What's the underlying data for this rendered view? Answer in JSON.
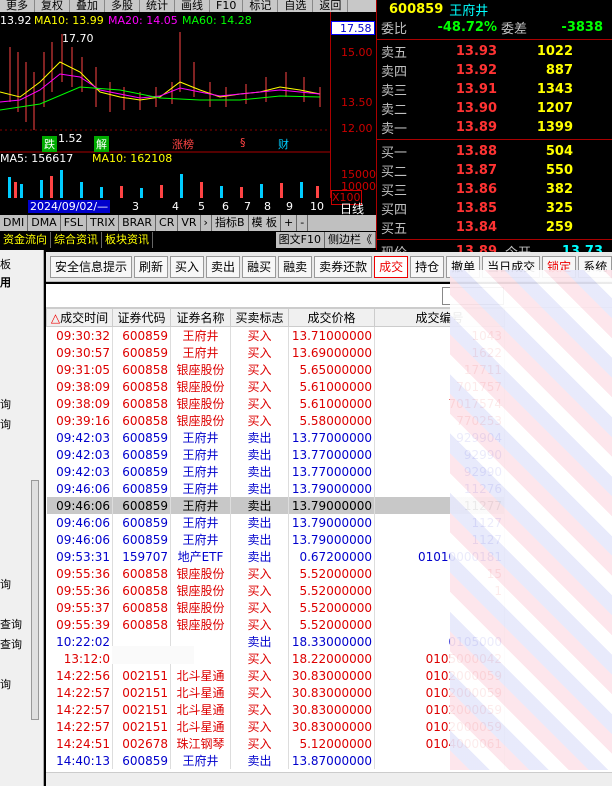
{
  "top_menu": [
    "更多",
    "复权",
    "叠加",
    "多股",
    "统计",
    "画线",
    "F10",
    "标记",
    "自选",
    "返回"
  ],
  "kline": {
    "ma_price": "13.92",
    "ma10": "MA10: 13.99",
    "ma20": "MA20: 14.05",
    "ma60": "MA60: 14.28",
    "high_label": "17.70",
    "low_label": "1.52",
    "events": [
      "跌",
      "解",
      "涨榜",
      "§",
      "财"
    ],
    "vol_ma5": "MA5: 156617",
    "vol_ma10": "MA10: 162108",
    "date_label": "2024/09/02/—",
    "x_ticks": [
      "3",
      "4",
      "5",
      "6",
      "7",
      "8",
      "9",
      "10"
    ],
    "axis": [
      "17.58",
      "15.00",
      "13.50",
      "12.00",
      "15000",
      "10000",
      "X100"
    ],
    "period_label": "日线",
    "colors": {
      "price_axis": "#cc0000",
      "ma10": "#ffff00",
      "ma20": "#ff00ff",
      "ma60": "#00ff00"
    }
  },
  "indicator_tabs": [
    "DMI",
    "DMA",
    "FSL",
    "TRIX",
    "BRAR",
    "CR",
    "VR",
    "›",
    "指标B",
    "模 板",
    "+",
    "-"
  ],
  "info_tabs": [
    "资金流向",
    "综合资讯",
    "板块资讯",
    "图文F10",
    "侧边栏《"
  ],
  "orderbook": {
    "code": "600859",
    "name": "王府井",
    "weibi_label": "委比",
    "weibi_value": "-48.72%",
    "weicha_label": "委差",
    "weicha_value": "-3838",
    "sells": [
      {
        "label": "卖五",
        "price": "13.93",
        "vol": "1022"
      },
      {
        "label": "卖四",
        "price": "13.92",
        "vol": "887"
      },
      {
        "label": "卖三",
        "price": "13.91",
        "vol": "1343"
      },
      {
        "label": "卖二",
        "price": "13.90",
        "vol": "1207"
      },
      {
        "label": "卖一",
        "price": "13.89",
        "vol": "1399"
      }
    ],
    "buys": [
      {
        "label": "买一",
        "price": "13.88",
        "vol": "504"
      },
      {
        "label": "买二",
        "price": "13.87",
        "vol": "550"
      },
      {
        "label": "买三",
        "price": "13.86",
        "vol": "382"
      },
      {
        "label": "买四",
        "price": "13.85",
        "vol": "325"
      },
      {
        "label": "买五",
        "price": "13.84",
        "vol": "259"
      }
    ],
    "current_label": "现价",
    "current_price": "13.89",
    "open_label": "今开",
    "open_price": "13.73"
  },
  "left_nav": [
    "板",
    "用",
    "询",
    "询",
    "询",
    "查询",
    "查询",
    "询"
  ],
  "toolbar": [
    "安全信息提示",
    "刷新",
    "买入",
    "卖出",
    "融买",
    "融卖",
    "卖券还款",
    "成交",
    "持仓",
    "撤单",
    "当日成交",
    "锁定",
    "系统"
  ],
  "active_tab": "成交",
  "table": {
    "headers": [
      "成交时间",
      "证券代码",
      "证券名称",
      "买卖标志",
      "成交价格",
      "成交编号"
    ],
    "rows": [
      {
        "time": "09:30:32",
        "code": "600859",
        "name": "王府井",
        "flag": "买入",
        "price": "13.71000000",
        "no": "1043",
        "side": "buy"
      },
      {
        "time": "09:30:57",
        "code": "600859",
        "name": "王府井",
        "flag": "买入",
        "price": "13.69000000",
        "no": "1622",
        "side": "buy"
      },
      {
        "time": "09:31:05",
        "code": "600858",
        "name": "银座股份",
        "flag": "买入",
        "price": "5.65000000",
        "no": "17711",
        "side": "buy"
      },
      {
        "time": "09:38:09",
        "code": "600858",
        "name": "银座股份",
        "flag": "买入",
        "price": "5.61000000",
        "no": "701757",
        "side": "buy"
      },
      {
        "time": "09:38:09",
        "code": "600858",
        "name": "银座股份",
        "flag": "买入",
        "price": "5.61000000",
        "no": "7017574",
        "side": "buy"
      },
      {
        "time": "09:39:16",
        "code": "600858",
        "name": "银座股份",
        "flag": "买入",
        "price": "5.58000000",
        "no": "770253",
        "side": "buy"
      },
      {
        "time": "09:42:03",
        "code": "600859",
        "name": "王府井",
        "flag": "卖出",
        "price": "13.77000000",
        "no": "929904",
        "side": "sell"
      },
      {
        "time": "09:42:03",
        "code": "600859",
        "name": "王府井",
        "flag": "卖出",
        "price": "13.77000000",
        "no": "92990",
        "side": "sell"
      },
      {
        "time": "09:42:03",
        "code": "600859",
        "name": "王府井",
        "flag": "卖出",
        "price": "13.77000000",
        "no": "92990",
        "side": "sell"
      },
      {
        "time": "09:46:06",
        "code": "600859",
        "name": "王府井",
        "flag": "卖出",
        "price": "13.79000000",
        "no": "11276",
        "side": "sell"
      },
      {
        "time": "09:46:06",
        "code": "600859",
        "name": "王府井",
        "flag": "卖出",
        "price": "13.79000000",
        "no": "11277",
        "side": "selected"
      },
      {
        "time": "09:46:06",
        "code": "600859",
        "name": "王府井",
        "flag": "卖出",
        "price": "13.79000000",
        "no": "1127",
        "side": "sell"
      },
      {
        "time": "09:46:06",
        "code": "600859",
        "name": "王府井",
        "flag": "卖出",
        "price": "13.79000000",
        "no": "1127",
        "side": "sell"
      },
      {
        "time": "09:53:31",
        "code": "159707",
        "name": "地产ETF",
        "flag": "卖出",
        "price": "0.67200000",
        "no": "01010000181",
        "side": "sell"
      },
      {
        "time": "09:55:36",
        "code": "600858",
        "name": "银座股份",
        "flag": "买入",
        "price": "5.52000000",
        "no": "15",
        "side": "buy"
      },
      {
        "time": "09:55:36",
        "code": "600858",
        "name": "银座股份",
        "flag": "买入",
        "price": "5.52000000",
        "no": "1",
        "side": "buy"
      },
      {
        "time": "09:55:37",
        "code": "600858",
        "name": "银座股份",
        "flag": "买入",
        "price": "5.52000000",
        "no": "",
        "side": "buy"
      },
      {
        "time": "09:55:39",
        "code": "600858",
        "name": "银座股份",
        "flag": "买入",
        "price": "5.52000000",
        "no": "",
        "side": "buy"
      },
      {
        "time": "10:22:02",
        "code": "",
        "name": "",
        "flag": "卖出",
        "price": "18.33000000",
        "no": "0105000",
        "side": "sell"
      },
      {
        "time": "13:12:0",
        "code": "",
        "name": "",
        "flag": "买入",
        "price": "18.22000000",
        "no": "0105000042",
        "side": "buy"
      },
      {
        "time": "14:22:56",
        "code": "002151",
        "name": "北斗星通",
        "flag": "买入",
        "price": "30.83000000",
        "no": "0102000059",
        "side": "buy"
      },
      {
        "time": "14:22:57",
        "code": "002151",
        "name": "北斗星通",
        "flag": "买入",
        "price": "30.83000000",
        "no": "0102000059",
        "side": "buy"
      },
      {
        "time": "14:22:57",
        "code": "002151",
        "name": "北斗星通",
        "flag": "买入",
        "price": "30.83000000",
        "no": "0102000059",
        "side": "buy"
      },
      {
        "time": "14:22:57",
        "code": "002151",
        "name": "北斗星通",
        "flag": "买入",
        "price": "30.83000000",
        "no": "0102000059",
        "side": "buy"
      },
      {
        "time": "14:24:51",
        "code": "002678",
        "name": "珠江钢琴",
        "flag": "买入",
        "price": "5.12000000",
        "no": "0104000061",
        "side": "buy"
      },
      {
        "time": "14:40:13",
        "code": "600859",
        "name": "王府井",
        "flag": "卖出",
        "price": "13.87000000",
        "no": "",
        "side": "sell"
      }
    ]
  }
}
